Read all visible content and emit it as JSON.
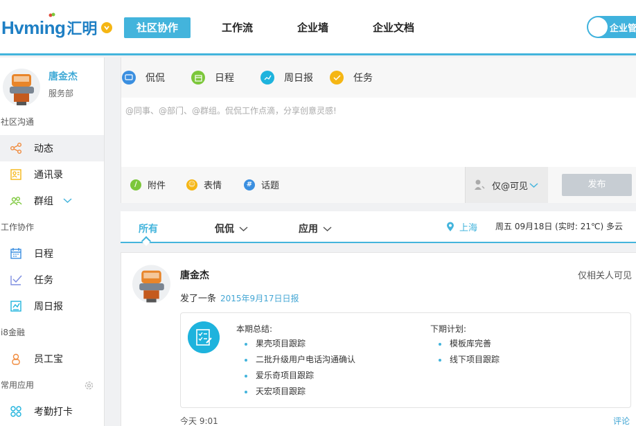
{
  "header": {
    "logo_text": "Hvming",
    "logo_cn": "汇明",
    "nav": [
      {
        "label": "社区协作",
        "active": true
      },
      {
        "label": "工作流",
        "active": false
      },
      {
        "label": "企业墙",
        "active": false
      },
      {
        "label": "企业文档",
        "active": false
      }
    ],
    "toggle_label": "企业管"
  },
  "sidebar": {
    "profile": {
      "name": "唐金杰",
      "dept": "服务部"
    },
    "sections": [
      {
        "title": "社区沟通",
        "items": [
          {
            "label": "动态",
            "icon": "share-icon",
            "active": true
          },
          {
            "label": "通讯录",
            "icon": "contacts-icon"
          },
          {
            "label": "群组",
            "icon": "group-icon",
            "has_chevron": true
          }
        ]
      },
      {
        "title": "工作协作",
        "items": [
          {
            "label": "日程",
            "icon": "calendar-icon"
          },
          {
            "label": "任务",
            "icon": "task-check-icon"
          },
          {
            "label": "周日报",
            "icon": "report-icon"
          }
        ]
      },
      {
        "title": "i8金融",
        "items": [
          {
            "label": "员工宝",
            "icon": "person-icon"
          }
        ]
      },
      {
        "title": "常用应用",
        "items": [
          {
            "label": "考勤打卡",
            "icon": "apps-grid-icon"
          }
        ]
      }
    ]
  },
  "composer": {
    "tabs": [
      {
        "label": "侃侃",
        "color": "#3b8fe0"
      },
      {
        "label": "日程",
        "color": "#7cc73a"
      },
      {
        "label": "周日报",
        "color": "#1eb3dd"
      },
      {
        "label": "任务",
        "color": "#f5b614"
      }
    ],
    "placeholder": "@同事、@部门、@群组。侃侃工作点滴，分享创意灵感!",
    "tools": [
      {
        "label": "附件",
        "color": "#7cc73a"
      },
      {
        "label": "表情",
        "color": "#f5b614"
      },
      {
        "label": "话题",
        "color": "#3b8fe0"
      }
    ],
    "visibility": "仅@可见",
    "publish": "发布"
  },
  "filter": {
    "tabs": [
      {
        "label": "所有",
        "active": true
      },
      {
        "label": "侃侃",
        "dropdown": true
      },
      {
        "label": "应用",
        "dropdown": true
      }
    ],
    "location": "上海",
    "weather": "周五 09月18日 (实时: 21℃) 多云"
  },
  "post": {
    "author": "唐金杰",
    "visibility": "仅相关人可见",
    "action": "发了一条",
    "link": "2015年9月17日日报",
    "summary_title": "本期总结:",
    "summary": [
      "果壳项目跟踪",
      "二批升级用户电话沟通确认",
      "爱乐奇项目跟踪",
      "天宏项目跟踪"
    ],
    "plan_title": "下期计划:",
    "plan": [
      "模板库完善",
      "线下项目跟踪"
    ],
    "time": "今天 9:01",
    "comment": "评论"
  }
}
